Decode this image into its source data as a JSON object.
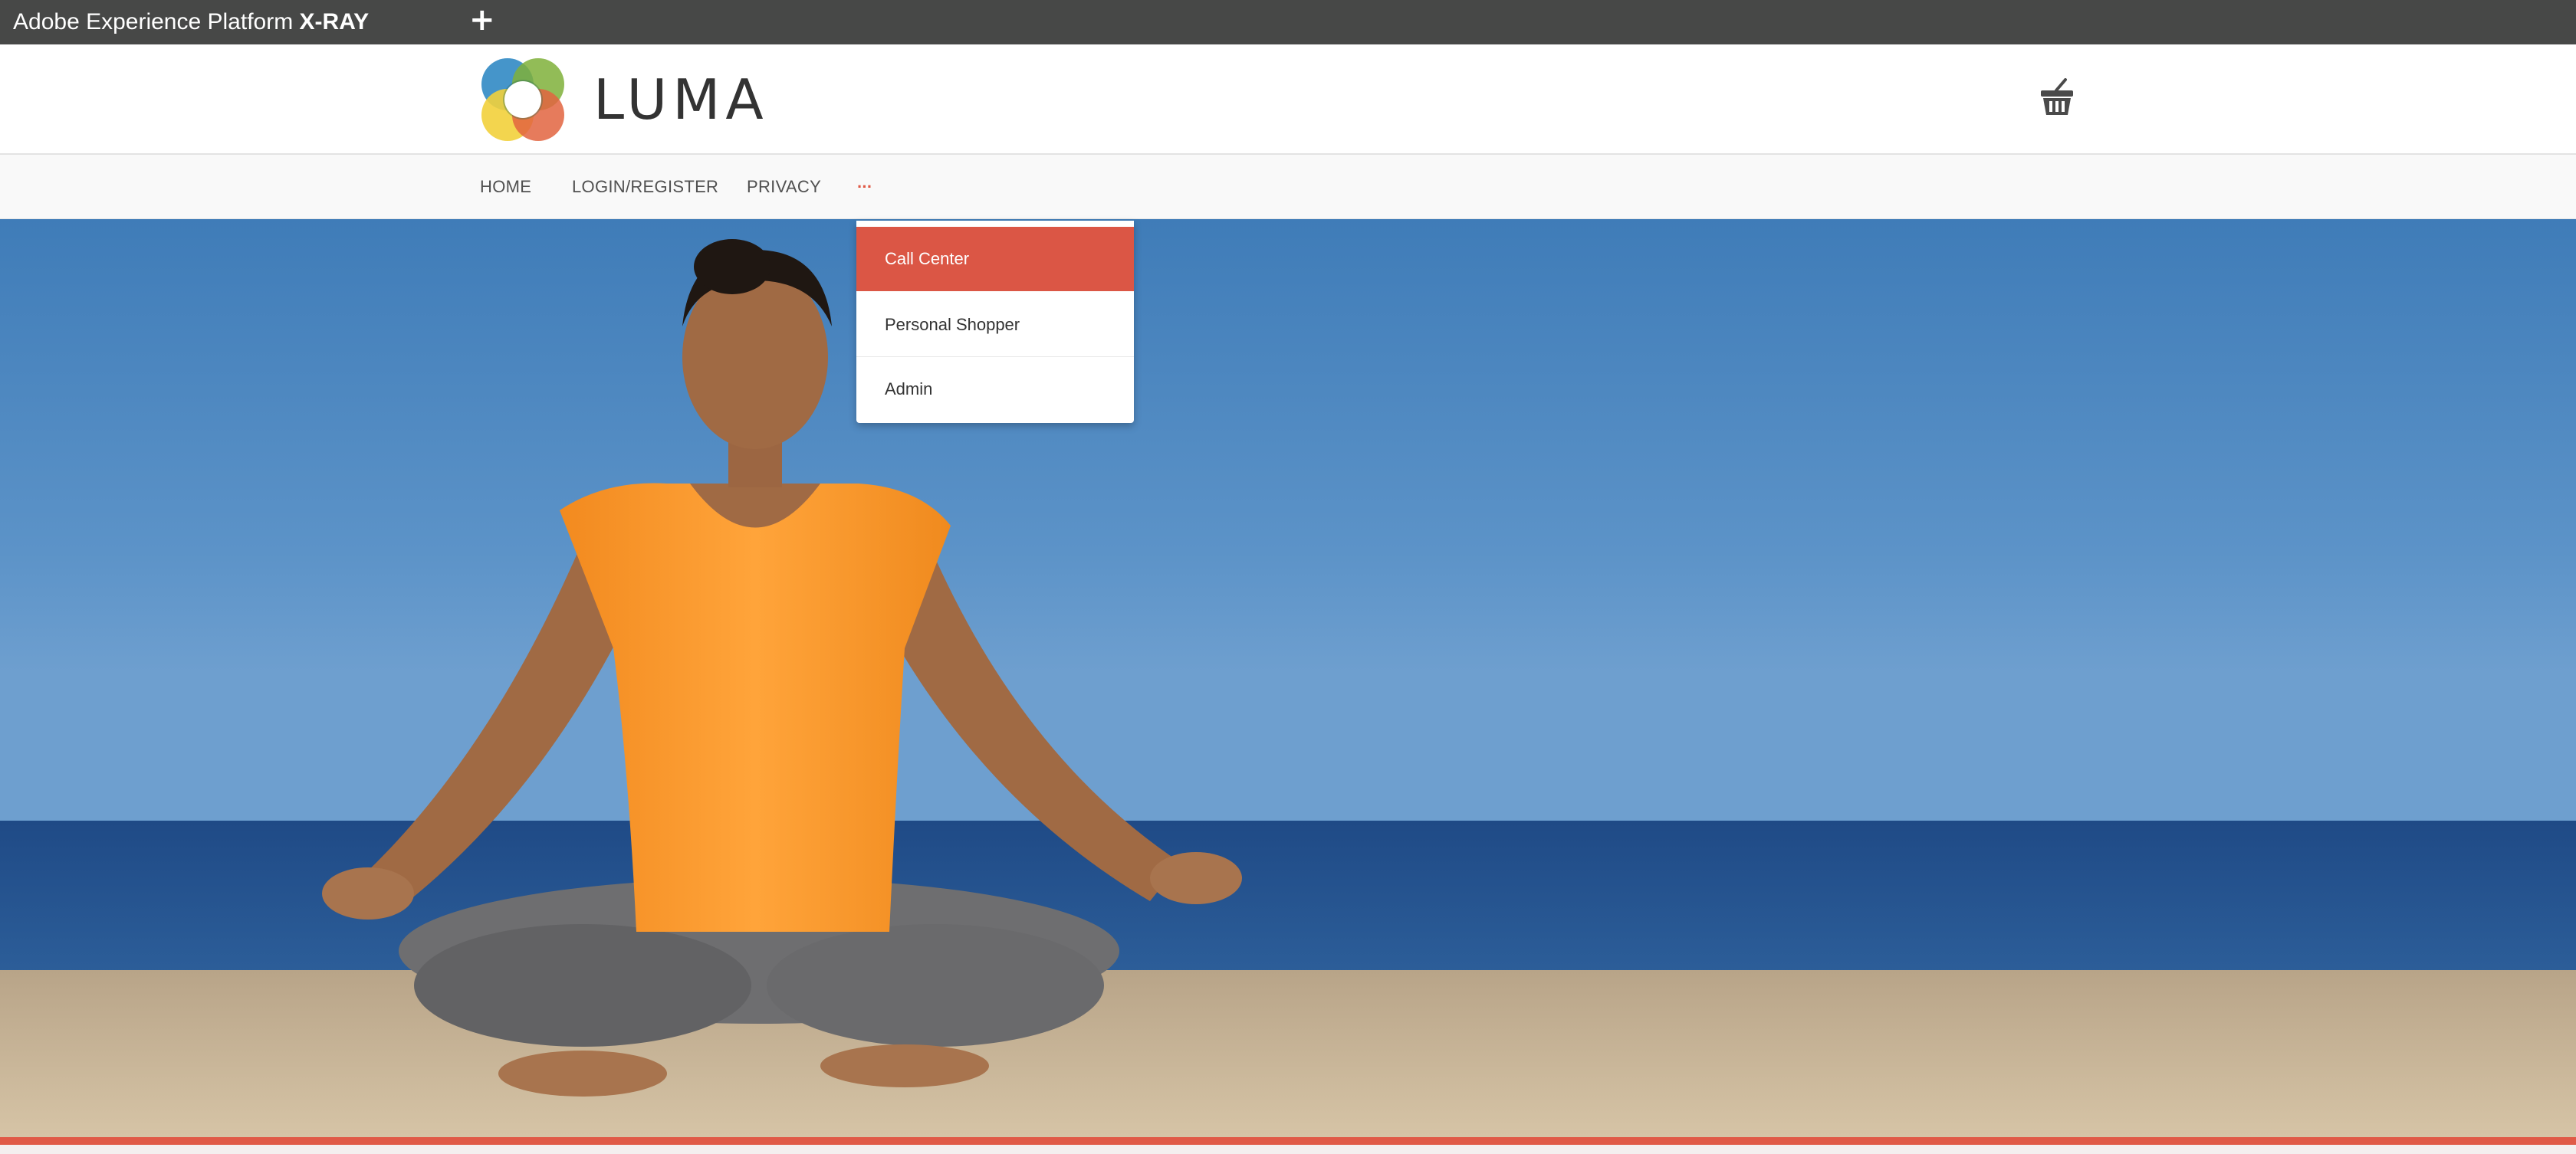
{
  "xray": {
    "title_prefix": "Adobe Experience Platform",
    "title_strong": "X-RAY",
    "add_symbol": "+"
  },
  "header": {
    "logo_text": "LUMA",
    "logo_icon": "luma-rings-logo",
    "cart_icon": "basket-icon"
  },
  "nav": {
    "items": [
      {
        "label": "HOME"
      },
      {
        "label": "LOGIN/REGISTER"
      },
      {
        "label": "PRIVACY"
      },
      {
        "label": "..."
      }
    ]
  },
  "dropdown": {
    "items": [
      {
        "label": "Call Center",
        "active": true
      },
      {
        "label": "Personal Shopper",
        "active": false
      },
      {
        "label": "Admin",
        "active": false
      }
    ]
  },
  "hero": {
    "image": "woman-meditating-on-beach-photo"
  },
  "colors": {
    "xray_bar": "#474847",
    "accent": "#db5645",
    "nav_bg": "#f9f9f9",
    "text": "#333333"
  }
}
